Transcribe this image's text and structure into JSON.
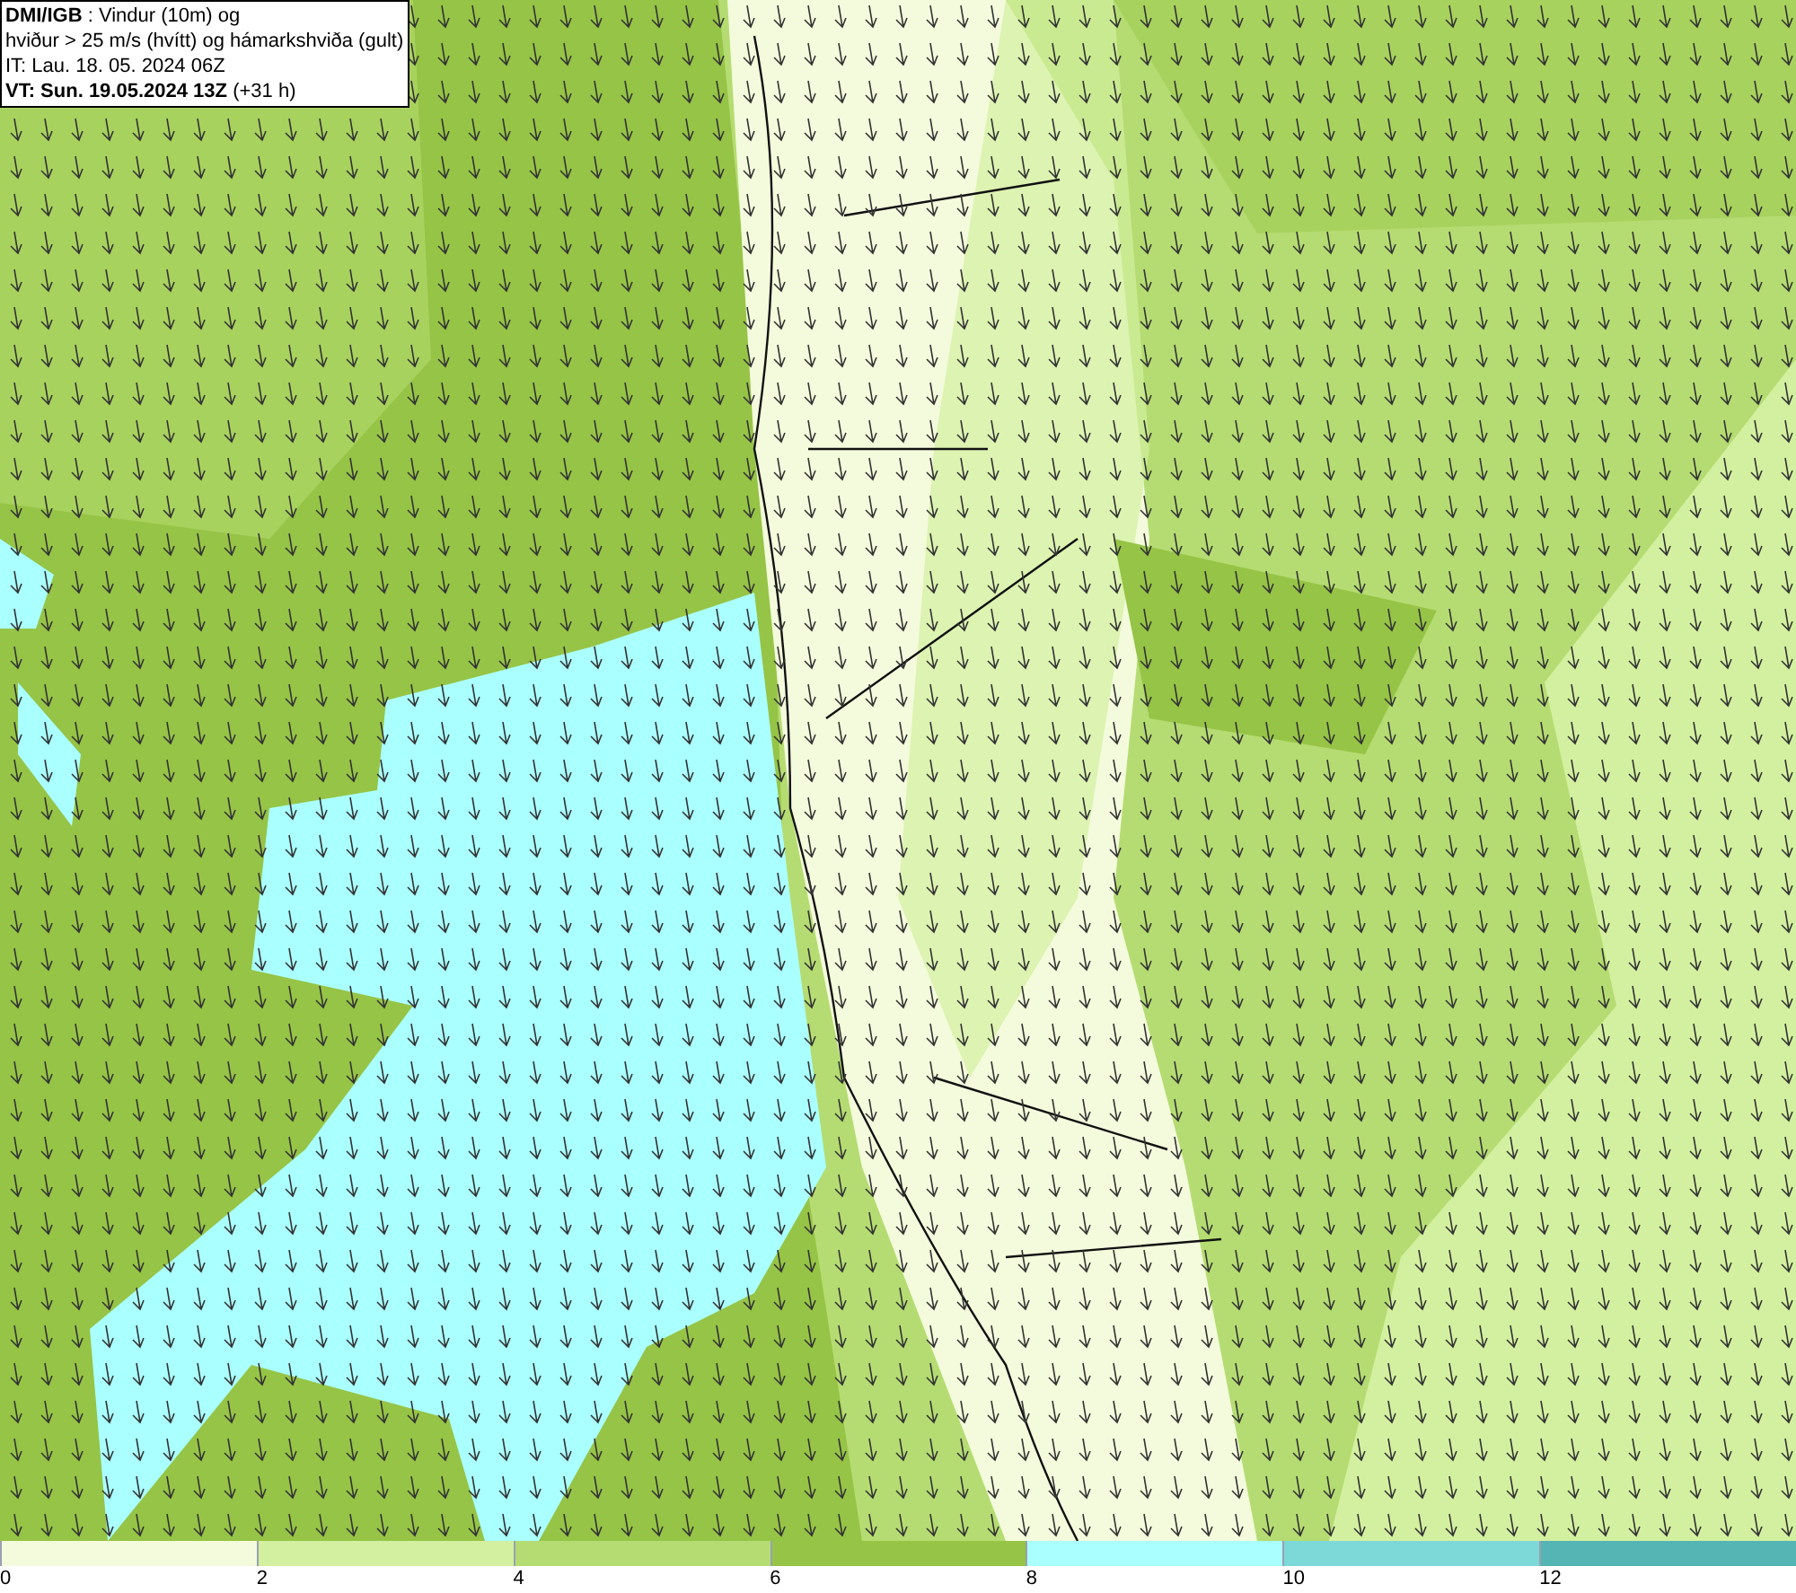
{
  "title_box": {
    "lines": [
      "**DMI/IGB** : Vindur (10m) og",
      "hviður > 25 m/s (hvítt) og hámarkshviða (gult)",
      "IT: Lau. 18. 05. 2024 06Z",
      "**VT: Sun. 19.05.2024 13Z** (+31 h)"
    ]
  },
  "legend": {
    "bins": [
      {
        "color": "#f4fbdc",
        "label": "0"
      },
      {
        "color": "#d3f0a0",
        "label": "2"
      },
      {
        "color": "#b5dc72",
        "label": "4"
      },
      {
        "color": "#96c446",
        "label": "6"
      },
      {
        "color": "#aaffff",
        "label": "8"
      },
      {
        "color": "#7dd8d8",
        "label": "10"
      },
      {
        "color": "#55b4b4",
        "label": "12"
      }
    ]
  }
}
